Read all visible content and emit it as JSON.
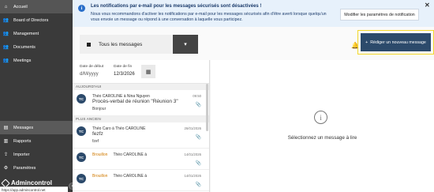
{
  "sidebar": {
    "items": [
      {
        "label": "Accueil",
        "icon": "home-icon",
        "glyph": "⌂"
      },
      {
        "label": "Board of Directors",
        "icon": "group-icon",
        "glyph": "👥"
      },
      {
        "label": "Management",
        "icon": "group-icon",
        "glyph": "👥"
      },
      {
        "label": "Documents",
        "icon": "group-icon",
        "glyph": "👥"
      },
      {
        "label": "Meetings",
        "icon": "group-icon",
        "glyph": "👥"
      }
    ],
    "bottom_items": [
      {
        "label": "Messages",
        "icon": "messages-icon",
        "glyph": "▤"
      },
      {
        "label": "Rapports",
        "icon": "bar-chart-icon",
        "glyph": "▥"
      },
      {
        "label": "Importer",
        "icon": "upload-icon",
        "glyph": "⇪"
      },
      {
        "label": "Paramètres",
        "icon": "gear-icon",
        "glyph": "⚙"
      }
    ],
    "logo_text": "Admincontrol",
    "url": "https://app.admincontrol.net",
    "collapse_glyph": "›"
  },
  "banner": {
    "icon_glyph": "i",
    "title": "Les notifications par e-mail pour les messages sécurisés sont désactivées !",
    "text": "Nous vous recommandons d'activer les notifications par e-mail pour les messages sécurisés afin d'être averti lorsque quelqu'un vous envoie un message ou répond à une conversation à laquelle vous participez.",
    "button": "Modifier les paramètres de notification",
    "close": "✕"
  },
  "filter": {
    "selected": "Tous les messages",
    "dropdown_glyph": "▾",
    "bell_glyph": "🔔"
  },
  "new_message_button": {
    "plus": "+",
    "label": "Rédiger un nouveau message"
  },
  "date_filter": {
    "start_label": "Date de début",
    "start_value": "d/M/yyyy",
    "end_label": "Date de fin",
    "end_value": "12/3/2026",
    "calendar_glyph": "▦"
  },
  "sections": {
    "today": "AUJOURD'HUI",
    "older": "PLUS ANCIEN"
  },
  "messages": [
    {
      "avatar": "TC",
      "from": "Théo CAROLINE à Nina Nguyen",
      "subject": "Procès-verbal de réunion \"Réunion 3\"",
      "preview": "Bonjour",
      "date": "09:50",
      "clip": "📎"
    },
    {
      "avatar": "TC",
      "from": "Théo Caro à Théo CAROLINE",
      "subject": "fezfz",
      "preview": "fzef",
      "date": "26/01/2026",
      "clip": "📎"
    },
    {
      "avatar": "TC",
      "draft": "Brouillon",
      "from": "Théo CAROLINE à",
      "date": "14/01/2026",
      "clip": "📎"
    },
    {
      "avatar": "TC",
      "draft": "Brouillon",
      "from": "Théo CAROLINE à",
      "date": "14/01/2026",
      "clip": "📎"
    }
  ],
  "reader": {
    "info_glyph": "i",
    "empty_text": "Sélectionnez un message à lire"
  }
}
